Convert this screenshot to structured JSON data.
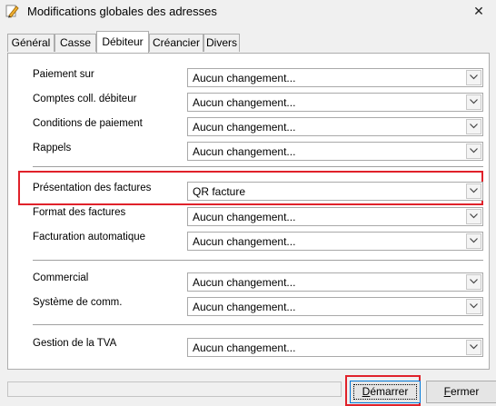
{
  "window": {
    "title": "Modifications globales des adresses",
    "close_glyph": "✕"
  },
  "tabs": [
    {
      "label": "Général"
    },
    {
      "label": "Casse"
    },
    {
      "label": "Débiteur"
    },
    {
      "label": "Créancier"
    },
    {
      "label": "Divers"
    }
  ],
  "active_tab": "Débiteur",
  "fields": [
    {
      "label": "Paiement sur",
      "value": "Aucun changement..."
    },
    {
      "label": "Comptes coll. débiteur",
      "value": "Aucun changement..."
    },
    {
      "label": "Conditions de paiement",
      "value": "Aucun changement..."
    },
    {
      "label": "Rappels",
      "value": "Aucun changement..."
    },
    {
      "label": "Présentation des factures",
      "value": "QR facture"
    },
    {
      "label": "Format des factures",
      "value": "Aucun changement..."
    },
    {
      "label": "Facturation automatique",
      "value": "Aucun changement..."
    },
    {
      "label": "Commercial",
      "value": "Aucun changement..."
    },
    {
      "label": "Système de comm.",
      "value": "Aucun changement..."
    },
    {
      "label": "Gestion de la TVA",
      "value": "Aucun changement..."
    }
  ],
  "buttons": {
    "start": {
      "mnemonic": "D",
      "rest": "émarrer"
    },
    "close": {
      "mnemonic": "F",
      "rest": "ermer"
    }
  },
  "colors": {
    "highlight": "#e0212a",
    "focus_border": "#0078d7"
  },
  "icons": {
    "app": "pencil-icon",
    "dropdown": "chevron-down-icon"
  }
}
